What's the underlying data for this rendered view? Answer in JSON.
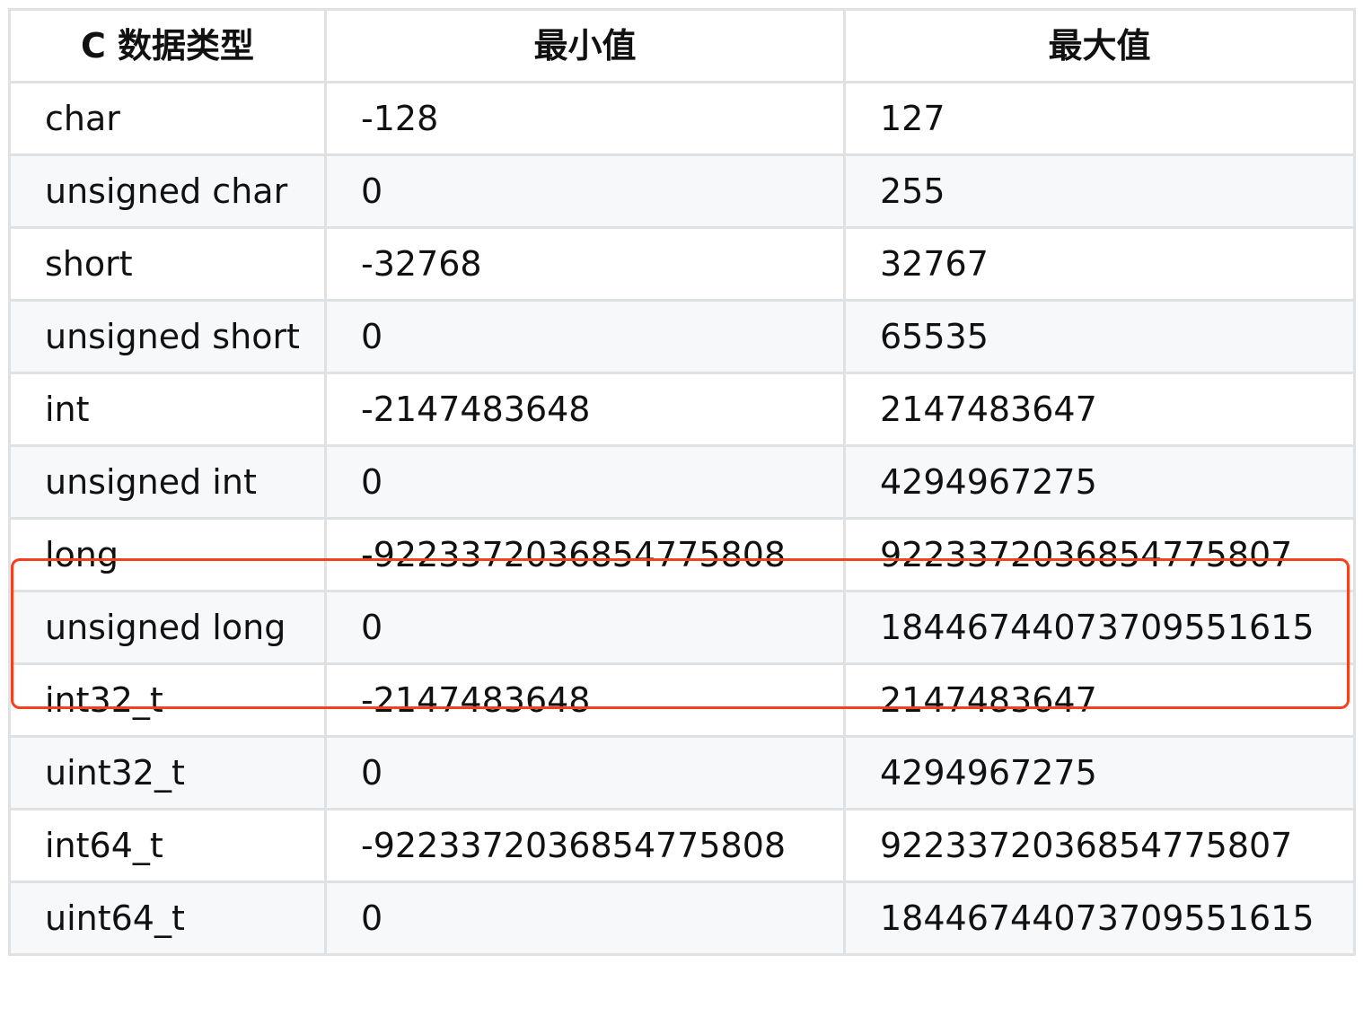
{
  "table": {
    "headers": [
      "C 数据类型",
      "最小值",
      "最大值"
    ],
    "rows": [
      [
        "char",
        "-128",
        "127"
      ],
      [
        "unsigned char",
        "0",
        "255"
      ],
      [
        "short",
        "-32768",
        "32767"
      ],
      [
        "unsigned short",
        "0",
        "65535"
      ],
      [
        "int",
        "-2147483648",
        "2147483647"
      ],
      [
        "unsigned int",
        "0",
        "4294967275"
      ],
      [
        "long",
        "-9223372036854775808",
        "9223372036854775807"
      ],
      [
        "unsigned long",
        "0",
        "18446744073709551615"
      ],
      [
        "int32_t",
        "-2147483648",
        "2147483647"
      ],
      [
        "uint32_t",
        "0",
        "4294967275"
      ],
      [
        "int64_t",
        "-9223372036854775808",
        "9223372036854775807"
      ],
      [
        "uint64_t",
        "0",
        "18446744073709551615"
      ]
    ]
  },
  "highlight": {
    "rows": [
      "long",
      "unsigned long"
    ],
    "color": "#f4401c"
  },
  "colors": {
    "border": "#dfe2e5",
    "stripe": "#f6f8fa",
    "text": "#111111"
  }
}
